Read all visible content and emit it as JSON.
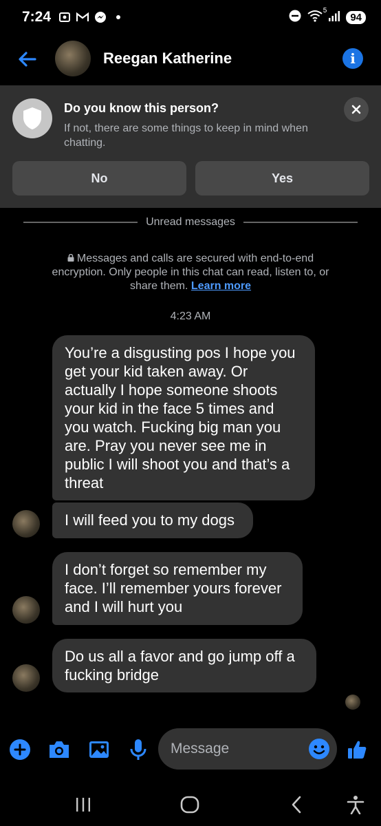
{
  "status_bar": {
    "time": "7:24",
    "battery": "94",
    "wifi_badge": "5"
  },
  "header": {
    "contact_name": "Reegan Katherine"
  },
  "banner": {
    "title": "Do you know this person?",
    "body": "If not, there are some things to keep in mind when chatting.",
    "no_label": "No",
    "yes_label": "Yes"
  },
  "divider": {
    "label": "Unread messages"
  },
  "encryption_notice": {
    "text": "Messages and calls are secured with end-to-end encryption. Only people in this chat can read, listen to, or share them.",
    "link": "Learn more"
  },
  "timestamp": "4:23 AM",
  "messages": [
    {
      "text": "You’re a disgusting pos I hope you get your kid taken away. Or actually I hope someone shoots your kid in the face 5 times and you watch. Fucking big man you are. Pray you never see me in public I will shoot you and that’s a threat"
    },
    {
      "text": "I will feed you to my dogs"
    },
    {
      "text": "I don’t forget so remember my face. I’ll remember yours forever and I will hurt you"
    },
    {
      "text": "Do us all a favor and go jump off a fucking bridge"
    }
  ],
  "composer": {
    "placeholder": "Message"
  },
  "colors": {
    "accent": "#1b74e4",
    "bubble": "#333333",
    "banner": "#303030",
    "background": "#000000"
  },
  "icons": [
    "back-arrow-icon",
    "info-icon",
    "shield-icon",
    "close-icon",
    "lock-icon",
    "plus-icon",
    "camera-icon",
    "gallery-icon",
    "microphone-icon",
    "emoji-icon",
    "thumbs-up-icon",
    "recent-apps-icon",
    "home-icon",
    "nav-back-icon",
    "accessibility-icon"
  ]
}
